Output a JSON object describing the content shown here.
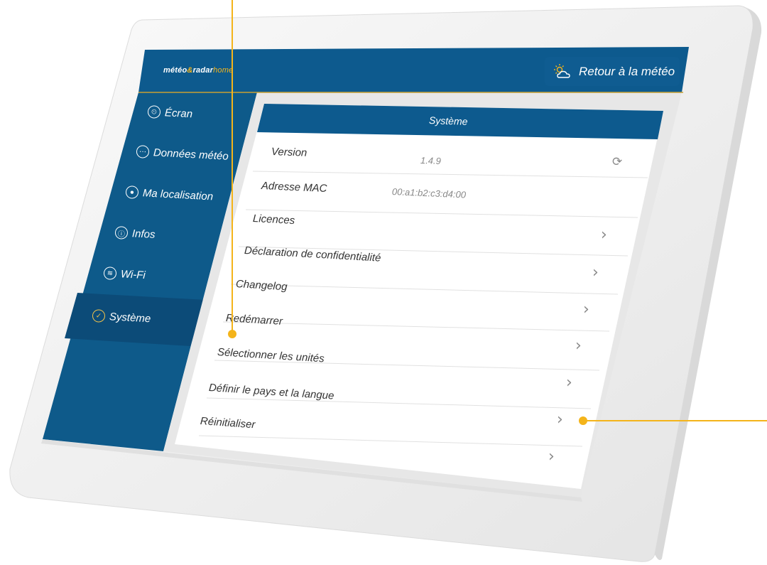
{
  "colors": {
    "header_blue": "#0d5a8e",
    "sidebar_blue": "#0e5a8a",
    "active_item": "#0c4c78",
    "accent_yellow": "#f4b41a",
    "bezel": "#f1f1f1"
  },
  "app": {
    "logo_main": "météo",
    "logo_amp": "&",
    "logo_radar": "radar",
    "logo_home": "home"
  },
  "header": {
    "back_button_label": "Retour à la météo",
    "back_button_icon": "sun-cloud-icon"
  },
  "sidebar": {
    "items": [
      {
        "label": "Écran",
        "icon": "clock-icon",
        "active": false
      },
      {
        "label": "Données météo",
        "icon": "dots-icon",
        "active": false
      },
      {
        "label": "Ma localisation",
        "icon": "location-pin-icon",
        "active": false
      },
      {
        "label": "Infos",
        "icon": "info-bulb-icon",
        "active": false
      },
      {
        "label": "Wi-Fi",
        "icon": "wifi-icon",
        "active": false
      },
      {
        "label": "Système",
        "icon": "check-circle-icon",
        "active": true
      }
    ]
  },
  "panel": {
    "title": "Système",
    "rows": [
      {
        "label": "Version",
        "value": "1.4.9",
        "action": "refresh-icon"
      },
      {
        "label": "Adresse MAC",
        "value": "00:a1:b2:c3:d4:00",
        "action": ""
      },
      {
        "label": "Licences",
        "value": "",
        "action": "chevron-right-icon"
      },
      {
        "label": "Déclaration de confidentialité",
        "value": "",
        "action": "chevron-right-icon"
      },
      {
        "label": "Changelog",
        "value": "",
        "action": "chevron-right-icon"
      },
      {
        "label": "Redémarrer",
        "value": "",
        "action": "chevron-right-icon"
      },
      {
        "label": "Sélectionner les unités",
        "value": "",
        "action": "chevron-right-icon"
      },
      {
        "label": "Définir le pays et la langue",
        "value": "",
        "action": "chevron-right-icon"
      },
      {
        "label": "Réinitialiser",
        "value": "",
        "action": "chevron-right-icon"
      }
    ]
  }
}
